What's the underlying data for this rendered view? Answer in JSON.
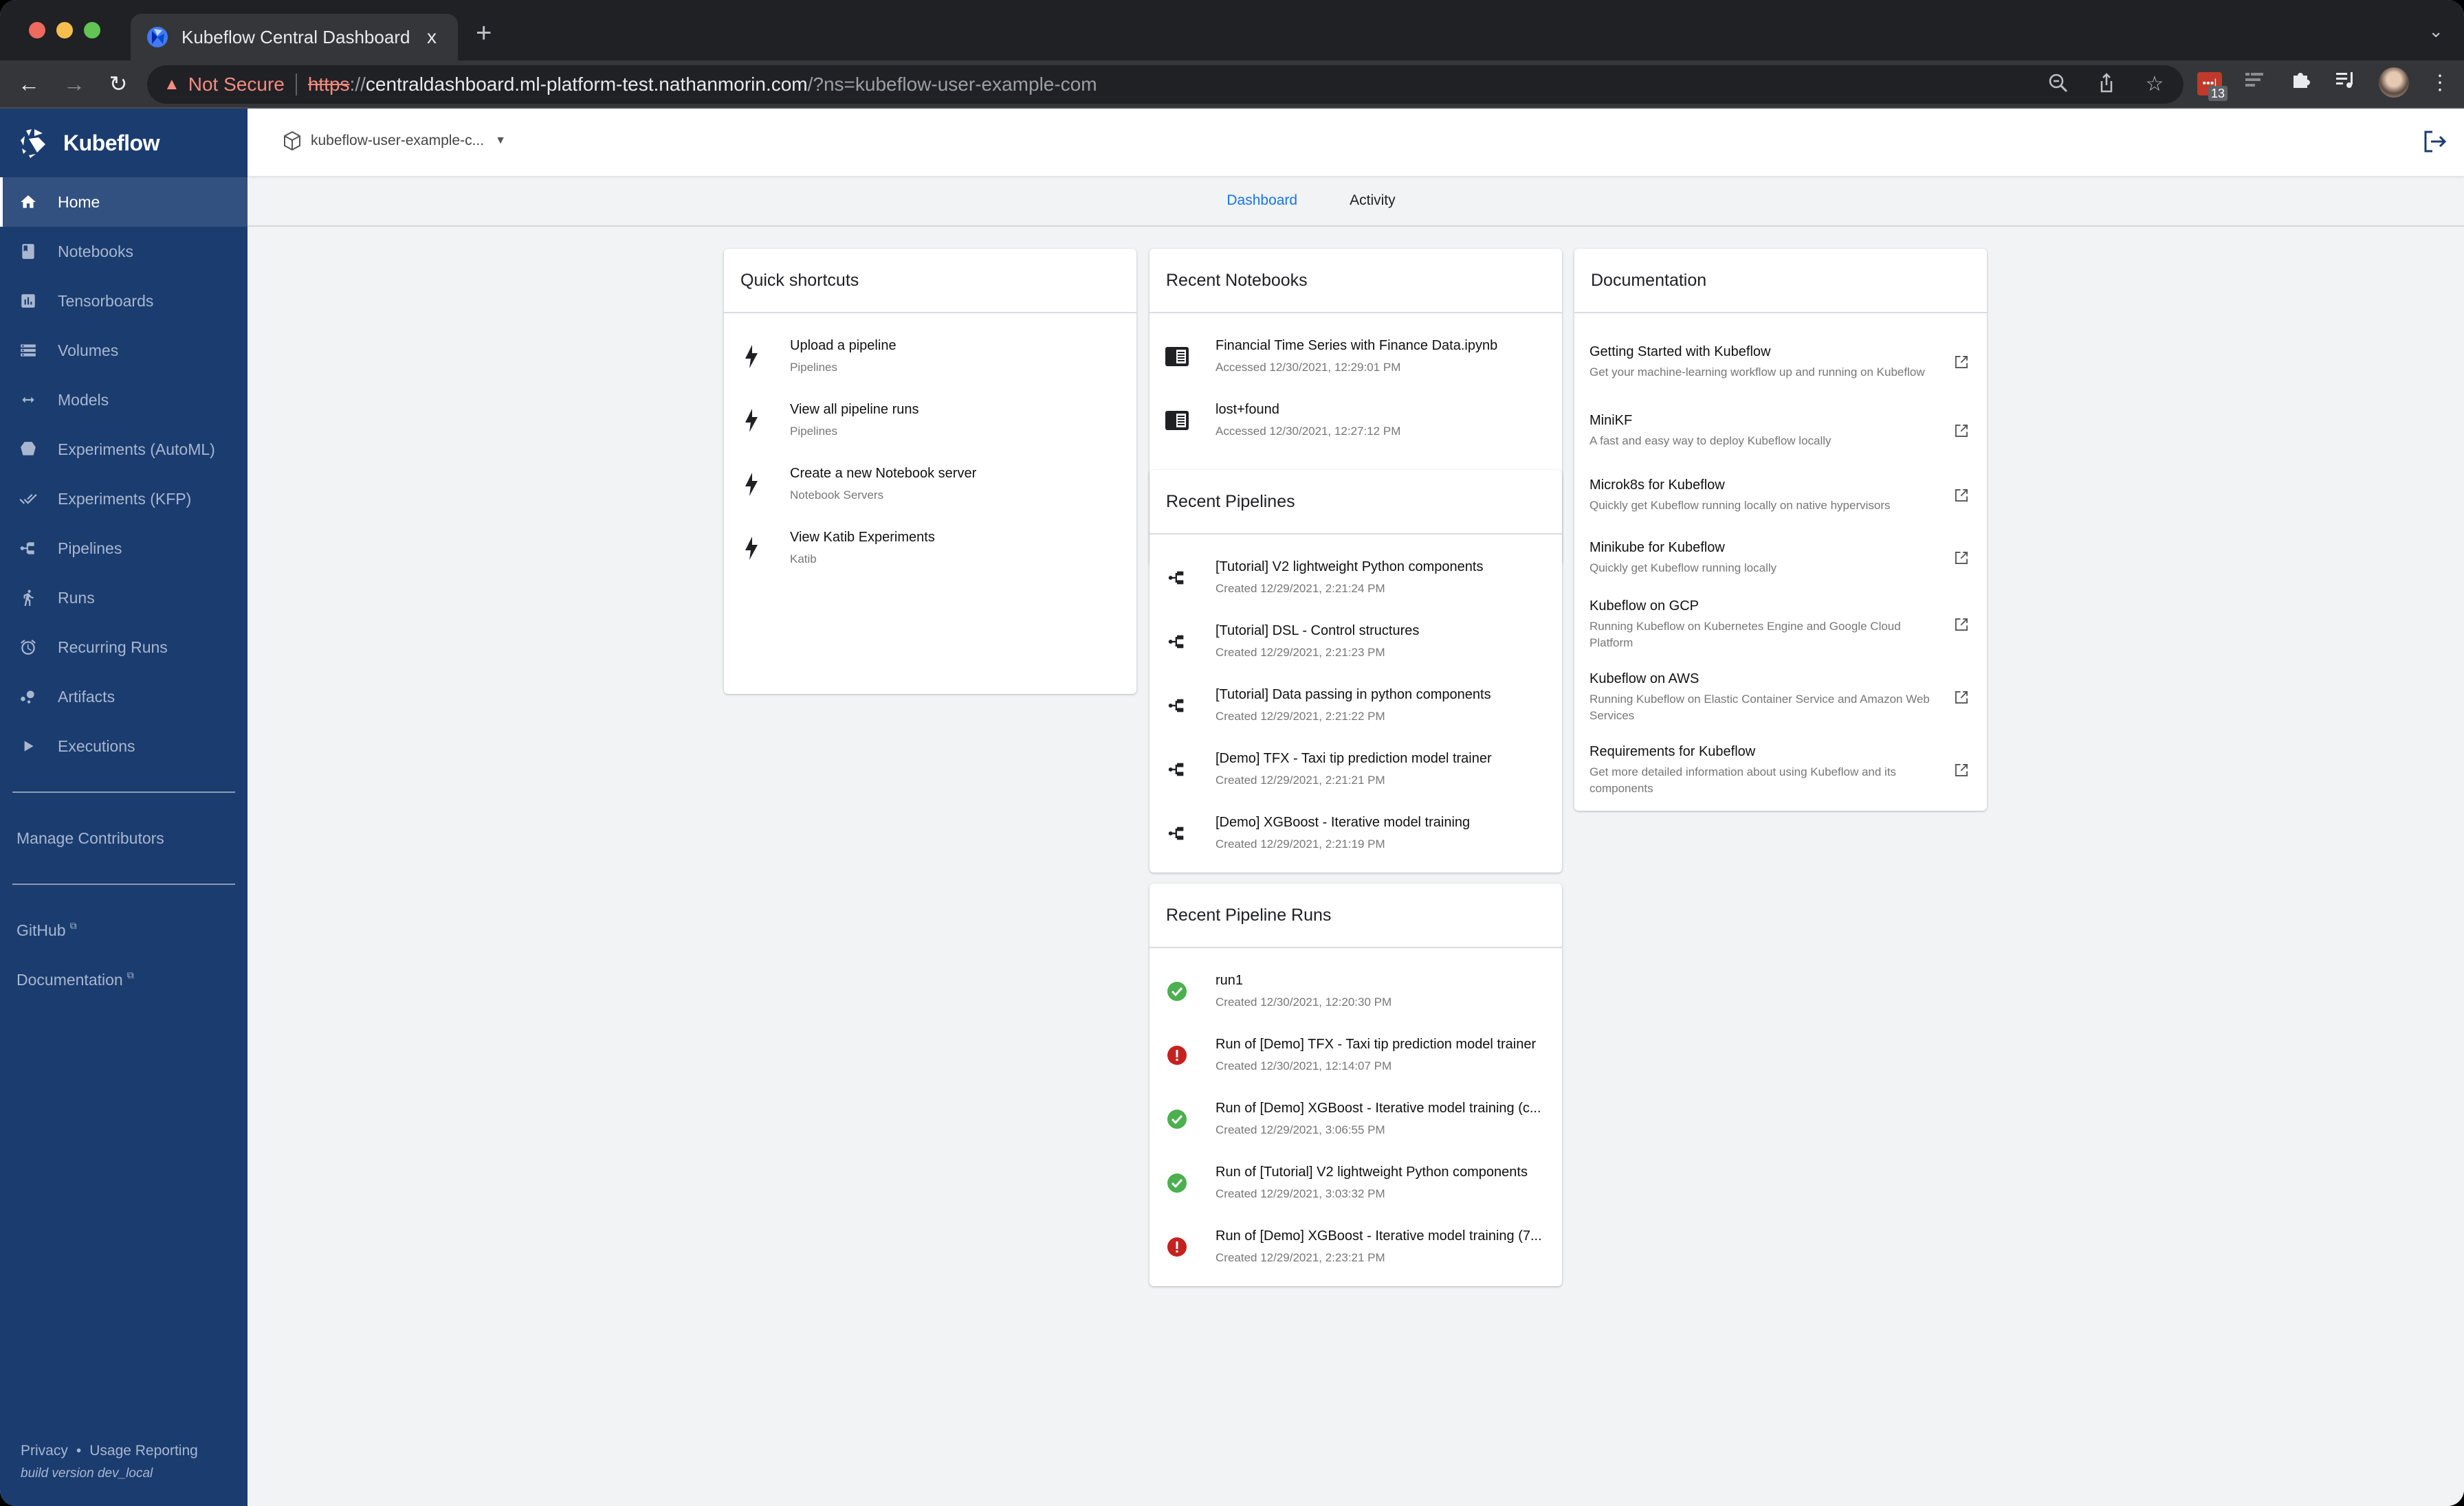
{
  "browser": {
    "tab_title": "Kubeflow Central Dashboard",
    "tab_close": "x",
    "new_tab": "+",
    "security_label": "Not Secure",
    "url_scheme": "https",
    "url_sep": "://",
    "url_host": "centraldashboard.ml-platform-test.nathanmorin.com",
    "url_path": "/?ns=kubeflow-user-example-com",
    "extension_badge": "13"
  },
  "sidebar": {
    "brand": "Kubeflow",
    "items": [
      {
        "label": "Home",
        "icon": "home-icon",
        "active": true
      },
      {
        "label": "Notebooks",
        "icon": "notebook-icon"
      },
      {
        "label": "Tensorboards",
        "icon": "tensorboard-icon"
      },
      {
        "label": "Volumes",
        "icon": "volumes-icon"
      },
      {
        "label": "Models",
        "icon": "models-icon"
      },
      {
        "label": "Experiments (AutoML)",
        "icon": "automl-icon"
      },
      {
        "label": "Experiments (KFP)",
        "icon": "kfp-icon"
      },
      {
        "label": "Pipelines",
        "icon": "pipeline-icon"
      },
      {
        "label": "Runs",
        "icon": "runs-icon"
      },
      {
        "label": "Recurring Runs",
        "icon": "alarm-icon"
      },
      {
        "label": "Artifacts",
        "icon": "artifacts-icon"
      },
      {
        "label": "Executions",
        "icon": "play-icon"
      }
    ],
    "manage_contributors": "Manage Contributors",
    "github": "GitHub",
    "documentation": "Documentation",
    "privacy": "Privacy",
    "footer_dot": "•",
    "usage_reporting": "Usage Reporting",
    "build_version": "build version dev_local"
  },
  "header": {
    "namespace": "kubeflow-user-example-c...",
    "tabs": [
      {
        "label": "Dashboard",
        "active": true
      },
      {
        "label": "Activity",
        "active": false
      }
    ]
  },
  "quick_shortcuts": {
    "title": "Quick shortcuts",
    "items": [
      {
        "title": "Upload a pipeline",
        "sub": "Pipelines"
      },
      {
        "title": "View all pipeline runs",
        "sub": "Pipelines"
      },
      {
        "title": "Create a new Notebook server",
        "sub": "Notebook Servers"
      },
      {
        "title": "View Katib Experiments",
        "sub": "Katib"
      }
    ]
  },
  "recent_notebooks": {
    "title": "Recent Notebooks",
    "items": [
      {
        "title": "Financial Time Series with Finance Data.ipynb",
        "sub": "Accessed 12/30/2021, 12:29:01 PM"
      },
      {
        "title": "lost+found",
        "sub": "Accessed 12/30/2021, 12:27:12 PM"
      }
    ]
  },
  "recent_pipelines": {
    "title": "Recent Pipelines",
    "items": [
      {
        "title": "[Tutorial] V2 lightweight Python components",
        "sub": "Created 12/29/2021, 2:21:24 PM"
      },
      {
        "title": "[Tutorial] DSL - Control structures",
        "sub": "Created 12/29/2021, 2:21:23 PM"
      },
      {
        "title": "[Tutorial] Data passing in python components",
        "sub": "Created 12/29/2021, 2:21:22 PM"
      },
      {
        "title": "[Demo] TFX - Taxi tip prediction model trainer",
        "sub": "Created 12/29/2021, 2:21:21 PM"
      },
      {
        "title": "[Demo] XGBoost - Iterative model training",
        "sub": "Created 12/29/2021, 2:21:19 PM"
      }
    ]
  },
  "recent_runs": {
    "title": "Recent Pipeline Runs",
    "status_colors": {
      "success": "#4caf50",
      "error": "#c5221f"
    },
    "items": [
      {
        "title": "run1",
        "sub": "Created 12/30/2021, 12:20:30 PM",
        "status": "success"
      },
      {
        "title": "Run of [Demo] TFX - Taxi tip prediction model trainer",
        "sub": "Created 12/30/2021, 12:14:07 PM",
        "status": "error"
      },
      {
        "title": "Run of [Demo] XGBoost - Iterative model training (c...",
        "sub": "Created 12/29/2021, 3:06:55 PM",
        "status": "success"
      },
      {
        "title": "Run of [Tutorial] V2 lightweight Python components",
        "sub": "Created 12/29/2021, 3:03:32 PM",
        "status": "success"
      },
      {
        "title": "Run of [Demo] XGBoost - Iterative model training (7...",
        "sub": "Created 12/29/2021, 2:23:21 PM",
        "status": "error"
      }
    ]
  },
  "documentation": {
    "title": "Documentation",
    "items": [
      {
        "title": "Getting Started with Kubeflow",
        "desc": "Get your machine-learning workflow up and running on Kubeflow"
      },
      {
        "title": "MiniKF",
        "desc": "A fast and easy way to deploy Kubeflow locally"
      },
      {
        "title": "Microk8s for Kubeflow",
        "desc": "Quickly get Kubeflow running locally on native hypervisors"
      },
      {
        "title": "Minikube for Kubeflow",
        "desc": "Quickly get Kubeflow running locally"
      },
      {
        "title": "Kubeflow on GCP",
        "desc": "Running Kubeflow on Kubernetes Engine and Google Cloud Platform"
      },
      {
        "title": "Kubeflow on AWS",
        "desc": "Running Kubeflow on Elastic Container Service and Amazon Web Services"
      },
      {
        "title": "Requirements for Kubeflow",
        "desc": "Get more detailed information about using Kubeflow and its components"
      }
    ]
  },
  "colors": {
    "sidebar_bg": "#1b3c6f",
    "sidebar_active": "#335180",
    "accent": "#1a73e8"
  }
}
